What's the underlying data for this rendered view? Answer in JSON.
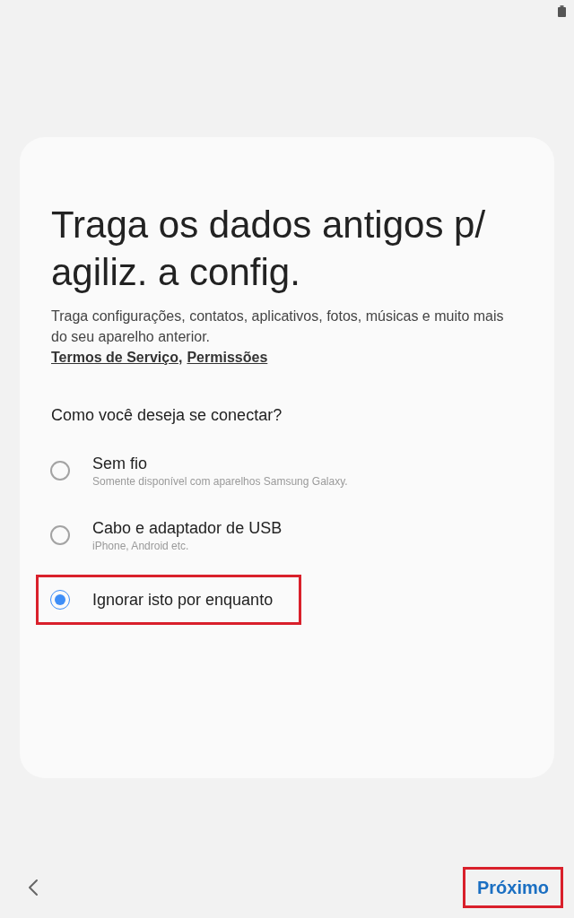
{
  "card": {
    "title": "Traga os dados antigos p/ agiliz. a config.",
    "description": "Traga configurações, contatos, aplicativos, fotos, músicas e muito mais do seu aparelho anterior.",
    "links": [
      {
        "label": "Termos de Serviço"
      },
      {
        "label": "Permissões"
      }
    ],
    "link_separator": ",",
    "question": "Como você deseja se conectar?",
    "options": [
      {
        "label": "Sem fio",
        "sublabel": "Somente disponível com aparelhos Samsung Galaxy.",
        "selected": false,
        "highlighted": false
      },
      {
        "label": "Cabo e adaptador de USB",
        "sublabel": "iPhone, Android etc.",
        "selected": false,
        "highlighted": false
      },
      {
        "label": "Ignorar isto por enquanto",
        "selected": true,
        "highlighted": true
      }
    ]
  },
  "footer": {
    "next_button": {
      "label": "Próximo",
      "highlighted": true
    }
  }
}
